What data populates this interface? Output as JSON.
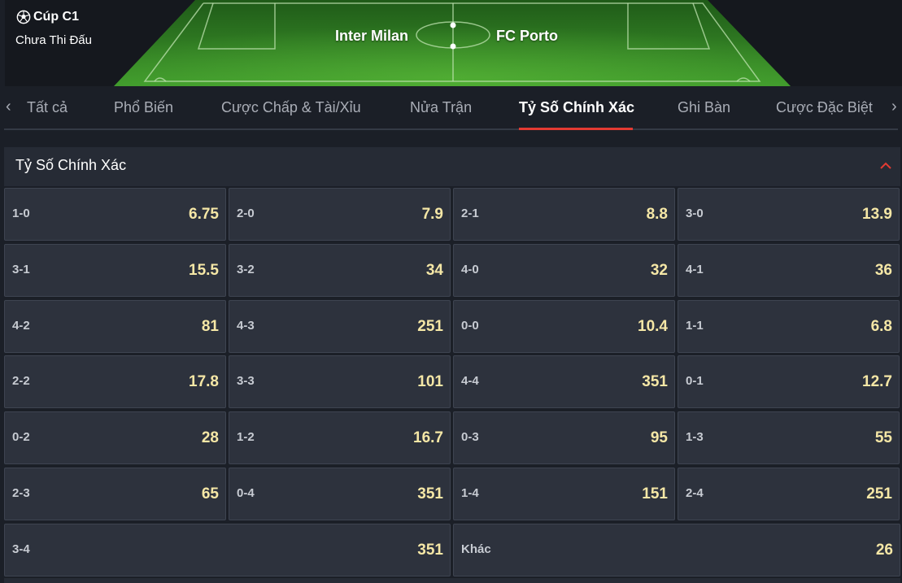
{
  "match": {
    "league": "Cúp C1",
    "status": "Chưa Thi Đấu",
    "home_team": "Inter Milan",
    "away_team": "FC Porto"
  },
  "tabs": [
    {
      "label": "Tất cả"
    },
    {
      "label": "Phổ Biến"
    },
    {
      "label": "Cược Chấp & Tài/Xỉu"
    },
    {
      "label": "Nửa Trận"
    },
    {
      "label": "Tỷ Số Chính Xác"
    },
    {
      "label": "Ghi Bàn"
    },
    {
      "label": "Cược Đặc Biệt"
    }
  ],
  "active_tab": "Tỷ Số Chính Xác",
  "section": {
    "title": "Tỷ Số Chính Xác"
  },
  "markets": [
    {
      "score": "1-0",
      "odds": "6.75"
    },
    {
      "score": "2-0",
      "odds": "7.9"
    },
    {
      "score": "2-1",
      "odds": "8.8"
    },
    {
      "score": "3-0",
      "odds": "13.9"
    },
    {
      "score": "3-1",
      "odds": "15.5"
    },
    {
      "score": "3-2",
      "odds": "34"
    },
    {
      "score": "4-0",
      "odds": "32"
    },
    {
      "score": "4-1",
      "odds": "36"
    },
    {
      "score": "4-2",
      "odds": "81"
    },
    {
      "score": "4-3",
      "odds": "251"
    },
    {
      "score": "0-0",
      "odds": "10.4"
    },
    {
      "score": "1-1",
      "odds": "6.8"
    },
    {
      "score": "2-2",
      "odds": "17.8"
    },
    {
      "score": "3-3",
      "odds": "101"
    },
    {
      "score": "4-4",
      "odds": "351"
    },
    {
      "score": "0-1",
      "odds": "12.7"
    },
    {
      "score": "0-2",
      "odds": "28"
    },
    {
      "score": "1-2",
      "odds": "16.7"
    },
    {
      "score": "0-3",
      "odds": "95"
    },
    {
      "score": "1-3",
      "odds": "55"
    },
    {
      "score": "2-3",
      "odds": "65"
    },
    {
      "score": "0-4",
      "odds": "351"
    },
    {
      "score": "1-4",
      "odds": "151"
    },
    {
      "score": "2-4",
      "odds": "251"
    },
    {
      "score": "3-4",
      "odds": "351"
    },
    {
      "score": "Khác",
      "odds": "26"
    }
  ],
  "colors": {
    "accent": "#e33a32",
    "odds": "#f5e7a6",
    "cell_bg": "#2d323d",
    "page_bg": "#1b1f27",
    "pitch": "#3f9a2c"
  },
  "icons": {
    "league": "soccer-ball-icon",
    "prev": "chevron-left-icon",
    "next": "chevron-right-icon",
    "collapse": "chevron-up-icon"
  }
}
